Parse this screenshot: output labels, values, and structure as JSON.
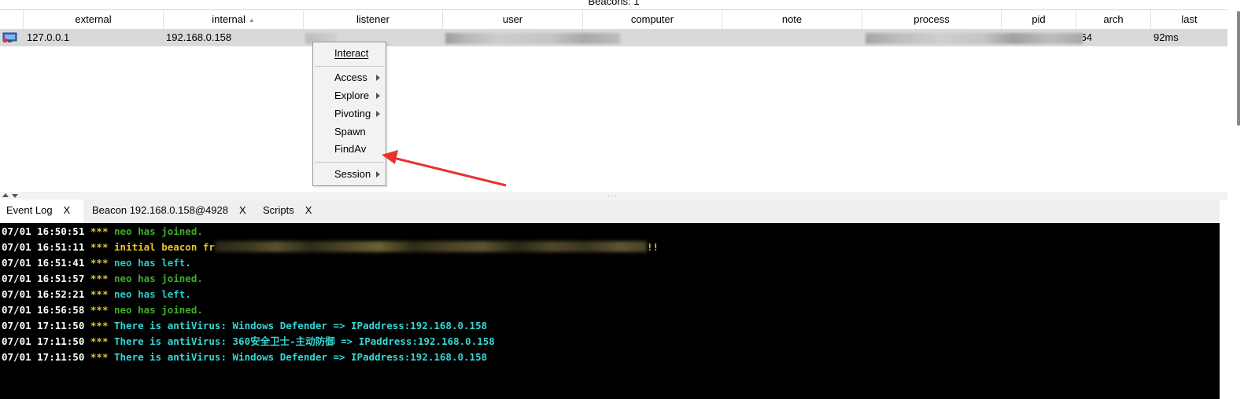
{
  "window": {
    "title": "Beacons: 1"
  },
  "table": {
    "columns": [
      {
        "label": "external"
      },
      {
        "label": "internal"
      },
      {
        "label": "listener"
      },
      {
        "label": "user"
      },
      {
        "label": "computer"
      },
      {
        "label": "note"
      },
      {
        "label": "process"
      },
      {
        "label": "pid"
      },
      {
        "label": "arch"
      },
      {
        "label": "last"
      }
    ],
    "sort_indicator": "▲",
    "row": {
      "icon": "monitor-beacon-icon",
      "external": "127.0.0.1",
      "internal": "192.168.0.158",
      "arch": "x64",
      "last": "92ms"
    }
  },
  "context_menu": {
    "items": [
      {
        "label": "Interact",
        "mnemonic": "I"
      },
      {
        "label": "Access",
        "mnemonic": "A",
        "submenu": true
      },
      {
        "label": "Explore",
        "mnemonic": "E",
        "submenu": true
      },
      {
        "label": "Pivoting",
        "mnemonic": "P",
        "submenu": true
      },
      {
        "label": "Spawn",
        "mnemonic": "S"
      },
      {
        "label": "FindAv",
        "mnemonic": "F"
      },
      {
        "label": "Session",
        "mnemonic": "S",
        "submenu": true
      }
    ]
  },
  "annotation": {
    "arrow_color": "#e8332c"
  },
  "tabs": [
    {
      "label": "Event Log",
      "close": "X",
      "active": true
    },
    {
      "label": "Beacon 192.168.0.158@4928",
      "close": "X",
      "active": false
    },
    {
      "label": "Scripts",
      "close": "X",
      "active": false
    }
  ],
  "event_log": [
    {
      "time": "07/01 16:50:51",
      "stars": "***",
      "text": "neo has joined.",
      "color": "green"
    },
    {
      "time": "07/01 16:51:11",
      "stars": "***",
      "text": "initial beacon fr",
      "suffix": "!!",
      "color": "yellow"
    },
    {
      "time": "07/01 16:51:41",
      "stars": "***",
      "text": "neo has left.",
      "color": "cyan"
    },
    {
      "time": "07/01 16:51:57",
      "stars": "***",
      "text": "neo has joined.",
      "color": "green"
    },
    {
      "time": "07/01 16:52:21",
      "stars": "***",
      "text": "neo has left.",
      "color": "cyan"
    },
    {
      "time": "07/01 16:56:58",
      "stars": "***",
      "text": "neo has joined.",
      "color": "green"
    },
    {
      "time": "07/01 17:11:50",
      "stars": "***",
      "text": "There is antiVirus: Windows Defender => IPaddress:192.168.0.158",
      "color": "cyan2"
    },
    {
      "time": "07/01 17:11:50",
      "stars": "***",
      "text": "There is antiVirus: 360安全卫士-主动防御 => IPaddress:192.168.0.158",
      "color": "cyan2"
    },
    {
      "time": "07/01 17:11:50",
      "stars": "***",
      "text": "There is antiVirus: Windows Defender => IPaddress:192.168.0.158",
      "color": "cyan2"
    }
  ],
  "colors": {
    "green": "#3fae27",
    "yellow": "#e8c228",
    "cyan": "#2ec8c8",
    "cyan2": "#36d6d6",
    "row_selected": "#d9d9d9",
    "console_bg": "#000000"
  }
}
